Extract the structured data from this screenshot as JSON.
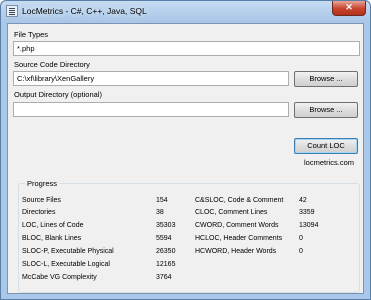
{
  "window": {
    "title": "LocMetrics - C#, C++, Java, SQL",
    "close_label": "✕"
  },
  "file_types": {
    "label": "File Types",
    "value": "*.php"
  },
  "source_dir": {
    "label": "Source Code Directory",
    "value": "C:\\xf\\library\\XenGallery",
    "browse_label": "Browse ..."
  },
  "output_dir": {
    "label": "Output Directory (optional)",
    "value": "",
    "browse_label": "Browse ..."
  },
  "count_button": "Count LOC",
  "website": "locmetrics.com",
  "progress": {
    "title": "Progress",
    "left": [
      {
        "label": "Source Files",
        "value": "154"
      },
      {
        "label": "Directories",
        "value": "38"
      },
      {
        "label": "LOC, Lines of Code",
        "value": "35303"
      },
      {
        "label": "BLOC, Blank Lines",
        "value": "5594"
      },
      {
        "label": "SLOC-P, Executable Physical",
        "value": "26350"
      },
      {
        "label": "SLOC-L, Executable Logical",
        "value": "12165"
      },
      {
        "label": "McCabe VG Complexity",
        "value": "3764"
      }
    ],
    "right": [
      {
        "label": "C&SLOC, Code & Comment",
        "value": "42"
      },
      {
        "label": "CLOC, Comment Lines",
        "value": "3359"
      },
      {
        "label": "CWORD, Comment Words",
        "value": "13094"
      },
      {
        "label": "HCLOC, Header Comments",
        "value": "0"
      },
      {
        "label": "HCWORD, Header Words",
        "value": "0"
      }
    ]
  }
}
